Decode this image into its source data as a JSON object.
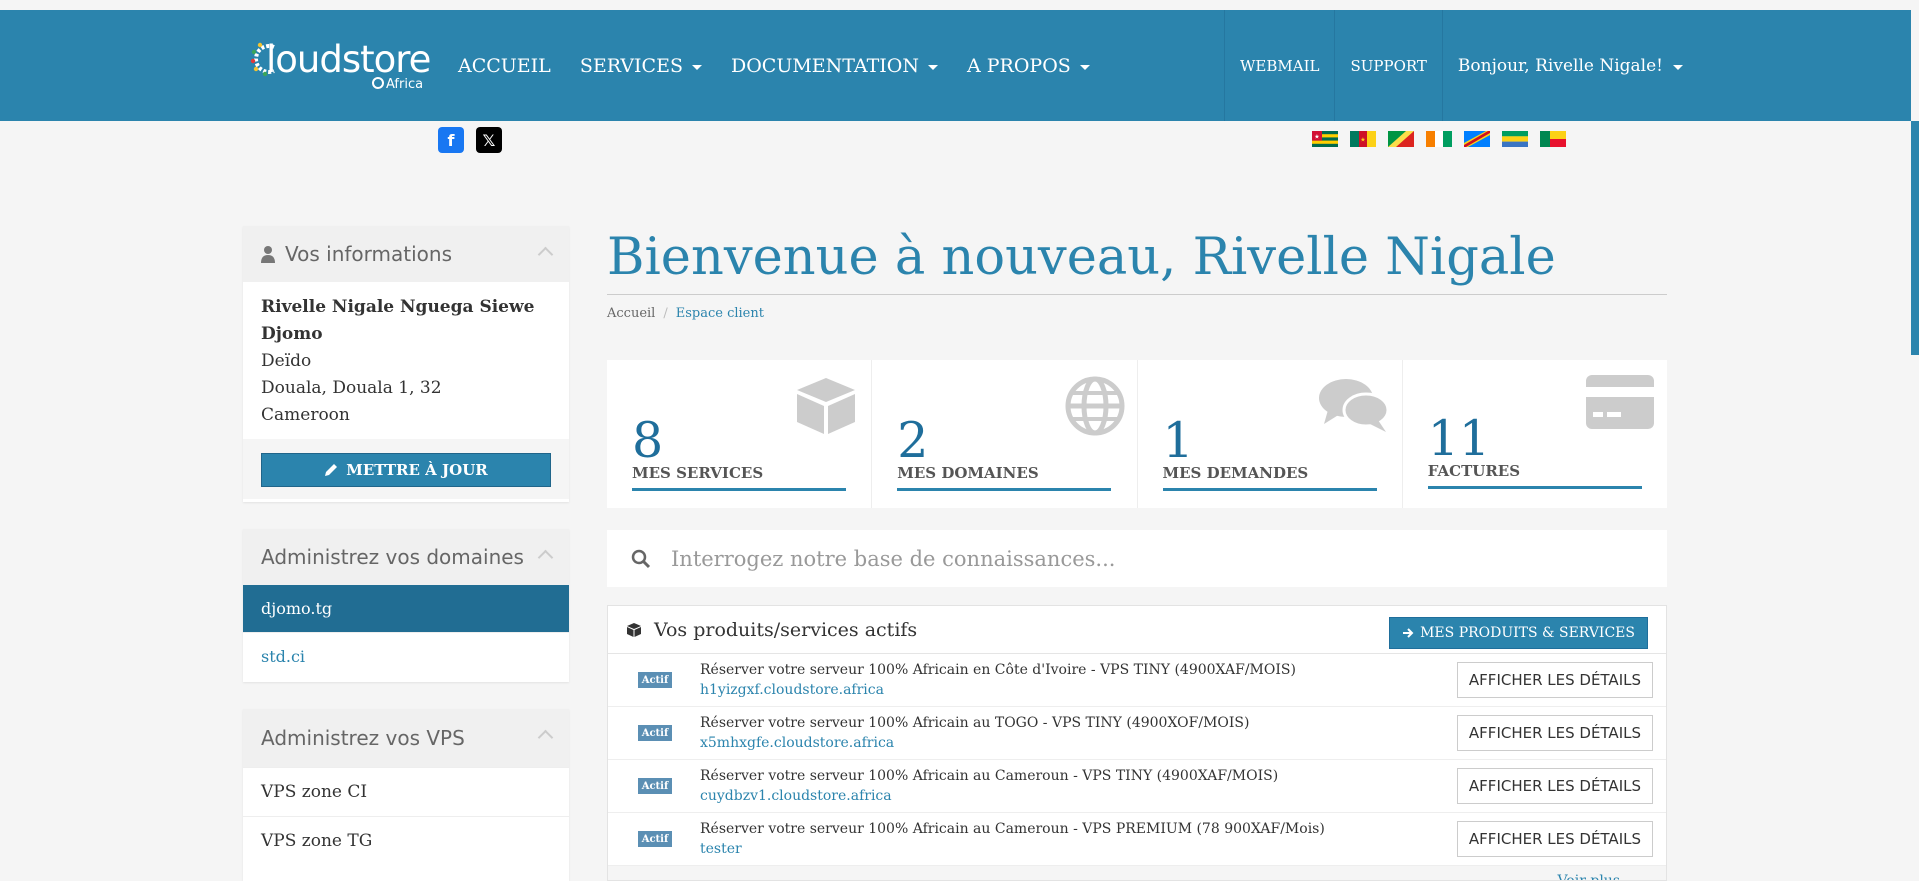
{
  "brand": {
    "logo_text": "loudstore",
    "logo_sub": "Africa"
  },
  "nav": {
    "items": [
      {
        "label": "ACCUEIL",
        "dropdown": false
      },
      {
        "label": "SERVICES",
        "dropdown": true
      },
      {
        "label": "DOCUMENTATION",
        "dropdown": true
      },
      {
        "label": "A PROPOS",
        "dropdown": true
      }
    ],
    "right": {
      "webmail": "WEBMAIL",
      "support": "SUPPORT",
      "user": "Bonjour, Rivelle Nigale!"
    }
  },
  "social": {
    "facebook": "f",
    "x": "𝕏"
  },
  "flags": [
    "Togo",
    "Cameroon",
    "Congo",
    "Côte d'Ivoire",
    "DR Congo",
    "Gabon",
    "Benin"
  ],
  "sidebar": {
    "info": {
      "title": "Vos informations",
      "name": "Rivelle Nigale Nguega Siewe Djomo",
      "address1": "Deïdo",
      "address2": "Douala, Douala 1, 32",
      "country": "Cameroon",
      "update_label": "METTRE À JOUR"
    },
    "domains": {
      "title": "Administrez vos domaines",
      "items": [
        "djomo.tg",
        "std.ci"
      ]
    },
    "vps": {
      "title": "Administrez vos VPS",
      "items": [
        "VPS zone CI",
        "VPS zone TG"
      ]
    }
  },
  "main": {
    "welcome": "Bienvenue à nouveau, Rivelle Nigale",
    "breadcrumb": {
      "home": "Accueil",
      "separator": "/",
      "current": "Espace client"
    },
    "stats": [
      {
        "value": "8",
        "label": "MES SERVICES",
        "icon": "cube-icon"
      },
      {
        "value": "2",
        "label": "MES DOMAINES",
        "icon": "globe-icon"
      },
      {
        "value": "1",
        "label": "MES DEMANDES",
        "icon": "comments-icon"
      },
      {
        "value": "11",
        "label": "FACTURES",
        "icon": "credit-card-icon"
      }
    ],
    "search_placeholder": "Interrogez notre base de connaissances...",
    "products": {
      "title": "Vos produits/services actifs",
      "button": "MES PRODUITS & SERVICES",
      "detail_label": "AFFICHER LES DÉTAILS",
      "rows": [
        {
          "status": "Actif",
          "name": "Réserver votre serveur 100% Africain en Côte d'Ivoire - VPS TINY (4900XAF/MOIS)",
          "domain": "h1yizgxf.cloudstore.africa"
        },
        {
          "status": "Actif",
          "name": "Réserver votre serveur 100% Africain au TOGO - VPS TINY (4900XOF/MOIS)",
          "domain": "x5mhxgfe.cloudstore.africa"
        },
        {
          "status": "Actif",
          "name": "Réserver votre serveur 100% Africain au Cameroun - VPS TINY (4900XAF/MOIS)",
          "domain": "cuydbzv1.cloudstore.africa"
        },
        {
          "status": "Actif",
          "name": "Réserver votre serveur 100% Africain au Cameroun - VPS PREMIUM (78 900XAF/Mois)",
          "domain": "tester"
        }
      ],
      "more": "Voir plus"
    }
  },
  "colors": {
    "primary": "#2b84ad",
    "primary_dark": "#1f6e9b",
    "active": "#216d93"
  }
}
